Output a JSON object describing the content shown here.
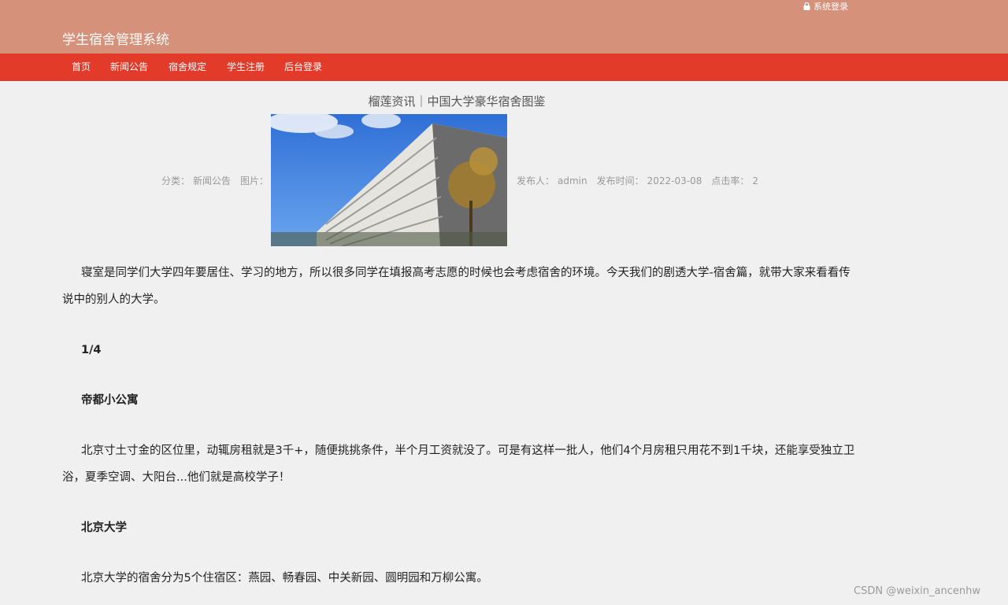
{
  "header": {
    "site_title": "学生宿舍管理系统",
    "login_label": "系统登录",
    "login_icon": "lock-icon"
  },
  "nav": {
    "items": [
      "首页",
      "新闻公告",
      "宿舍规定",
      "学生注册",
      "后台登录"
    ]
  },
  "article": {
    "title": "榴莲资讯｜中国大学豪华宿舍图鉴",
    "category_label": "分类：",
    "category": "新闻公告",
    "image_label": "图片：",
    "publisher_label": "发布人：",
    "publisher": "admin",
    "date_label": "发布时间：",
    "date": "2022-03-08",
    "clicks_label": "点击率：",
    "clicks": "2",
    "paragraphs": [
      "寝室是同学们大学四年要居住、学习的地方，所以很多同学在填报高考志愿的时候也会考虑宿舍的环境。今天我们的剧透大学-宿舍篇，就带大家来看看传说中的别人的大学。",
      "1/4",
      "帝都小公寓",
      "北京寸土寸金的区位里，动辄房租就是3千+，随便挑挑条件，半个月工资就没了。可是有这样一批人，他们4个月房租只用花不到1千块，还能享受独立卫浴，夏季空调、大阳台...他们就是高校学子！",
      "北京大学",
      "北京大学的宿舍分为5个住宿区：燕园、畅春园、中关新园、圆明园和万柳公寓。"
    ]
  },
  "watermark": "CSDN @weixin_ancenhw",
  "colors": {
    "topbar": "#d6917a",
    "navbar": "#e23b2a",
    "background": "#f0f0f0"
  }
}
